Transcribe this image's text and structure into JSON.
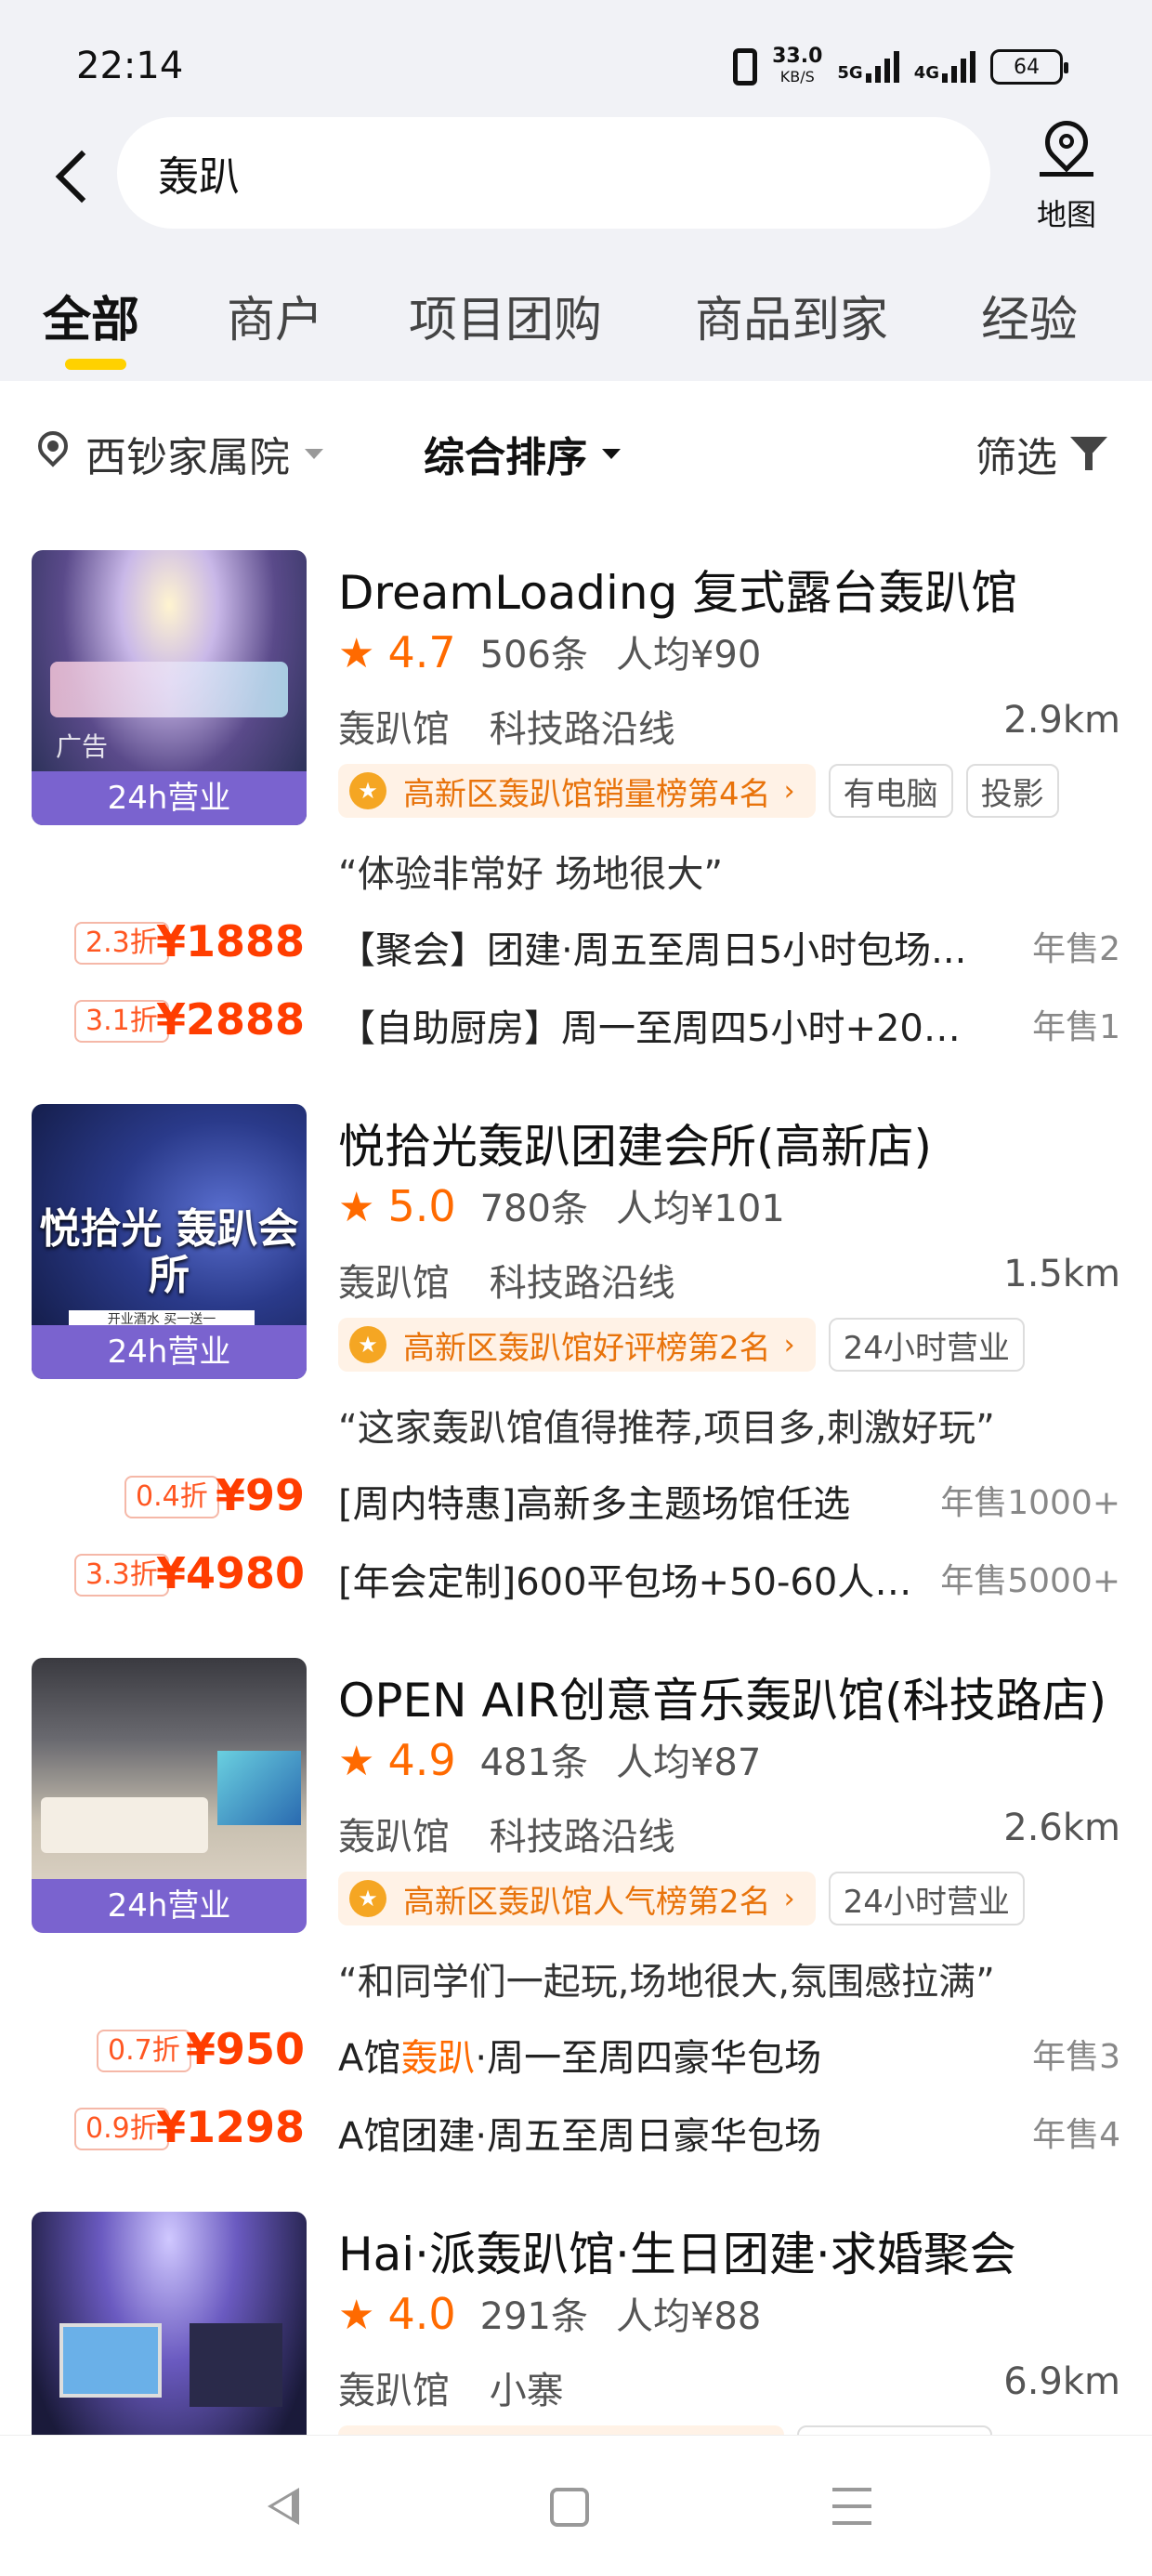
{
  "status_bar": {
    "time": "22:14",
    "speed_value": "33.0",
    "speed_unit": "KB/S",
    "network_1": "5G",
    "network_2": "4G",
    "battery": "64"
  },
  "header": {
    "search_query": "轰趴",
    "map_label": "地图"
  },
  "tabs": [
    "全部",
    "商户",
    "项目团购",
    "商品到家",
    "经验"
  ],
  "active_tab": 0,
  "filter_bar": {
    "location": "西钞家属院",
    "sort": "综合排序",
    "filter": "筛选"
  },
  "listings": [
    {
      "name": "DreamLoading 复式露台轰趴馆",
      "rating": "4.7",
      "reviews": "506条",
      "avg_price": "人均¥90",
      "category": "轰趴馆",
      "area": "科技路沿线",
      "distance": "2.9km",
      "rank_badge": "高新区轰趴馆销量榜第4名",
      "tags": [
        "有电脑",
        "投影"
      ],
      "review_quote": "“体验非常好 场地很大”",
      "ribbon": "24h营业",
      "ad_label": "广告",
      "deals": [
        {
          "discount": "2.3折",
          "price": "¥1888",
          "title": "【聚会】团建·周五至周日5小时包场...",
          "sold": "年售2"
        },
        {
          "discount": "3.1折",
          "price": "¥2888",
          "title": "【自助厨房】周一至周四5小时+20人...",
          "sold": "年售1"
        }
      ]
    },
    {
      "name": "悦拾光轰趴团建会所(高新店)",
      "rating": "5.0",
      "reviews": "780条",
      "avg_price": "人均¥101",
      "category": "轰趴馆",
      "area": "科技路沿线",
      "distance": "1.5km",
      "rank_badge": "高新区轰趴馆好评榜第2名",
      "tags": [
        "24小时营业"
      ],
      "review_quote": "“这家轰趴馆值得推荐,项目多,刺激好玩”",
      "ribbon": "24h营业",
      "poster_text": "悦拾光 轰趴会所",
      "poster_sub": "开业酒水 买一送一",
      "deals": [
        {
          "discount": "0.4折",
          "price": "¥99",
          "title": "[周内特惠]高新多主题场馆任选",
          "sold": "年售1000+"
        },
        {
          "discount": "3.3折",
          "price": "¥4980",
          "title": "[年会定制]600平包场+50-60人火...",
          "sold": "年售5000+"
        }
      ]
    },
    {
      "name": "OPEN AIR创意音乐轰趴馆(科技路店)",
      "rating": "4.9",
      "reviews": "481条",
      "avg_price": "人均¥87",
      "category": "轰趴馆",
      "area": "科技路沿线",
      "distance": "2.6km",
      "rank_badge": "高新区轰趴馆人气榜第2名",
      "tags": [
        "24小时营业"
      ],
      "review_quote": "“和同学们一起玩,场地很大,氛围感拉满”",
      "ribbon": "24h营业",
      "deals": [
        {
          "discount": "0.7折",
          "price": "¥950",
          "title_pre": "A馆",
          "title_hl": "轰趴",
          "title_post": "·周一至周四豪华包场",
          "sold": "年售3"
        },
        {
          "discount": "0.9折",
          "price": "¥1298",
          "title": "A馆团建·周五至周日豪华包场",
          "sold": "年售4"
        }
      ]
    },
    {
      "name": "Hai·派轰趴馆·生日团建·求婚聚会",
      "rating": "4.0",
      "reviews": "291条",
      "avg_price": "人均¥88",
      "category": "轰趴馆",
      "area": "小寨",
      "distance": "6.9km"
    }
  ],
  "colors": {
    "accent_yellow": "#ffd100",
    "price_red": "#ff3d00",
    "rating_orange": "#ff6a00",
    "ribbon_purple": "#7a63cf",
    "header_bg": "#f1f2f6"
  },
  "icons": [
    "back-arrow-icon",
    "map-pin-icon",
    "location-icon",
    "dropdown-triangle-icon",
    "funnel-icon",
    "star-icon",
    "medal-icon",
    "chevron-right-icon",
    "nav-back-icon",
    "nav-home-icon",
    "nav-menu-icon"
  ]
}
